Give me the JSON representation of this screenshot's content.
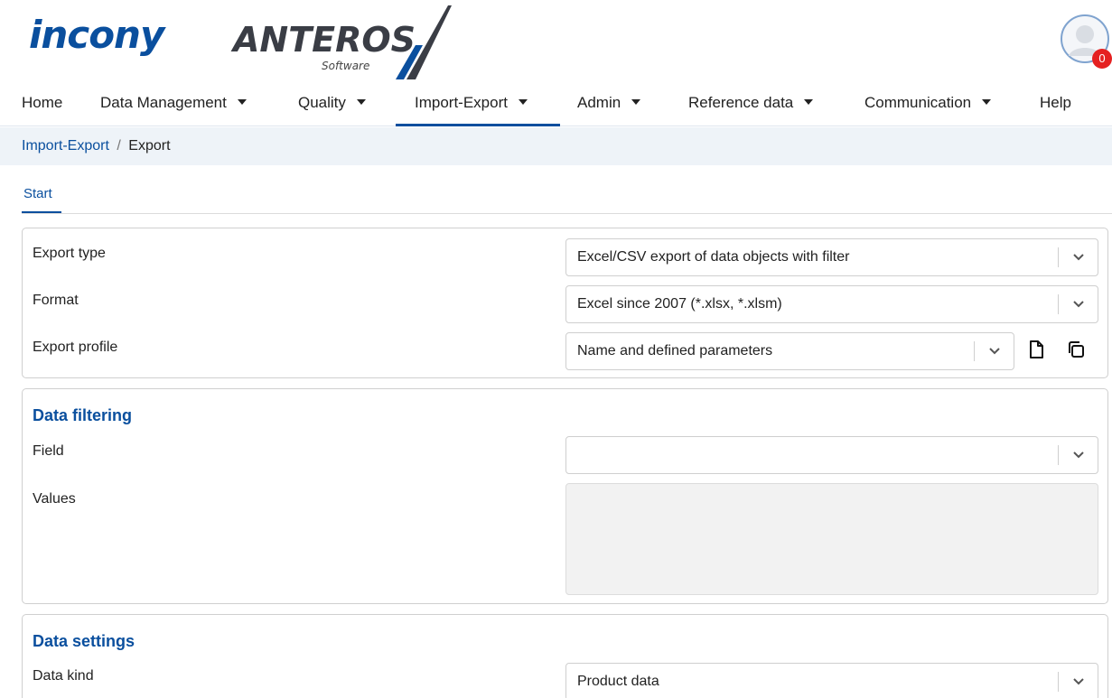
{
  "brand": {
    "logo_left": "incony",
    "logo_right": "ANTEROS",
    "logo_sub": "Software"
  },
  "notifications": {
    "count": "0"
  },
  "nav": {
    "items": [
      {
        "label": "Home",
        "has_caret": false
      },
      {
        "label": "Data Management",
        "has_caret": true
      },
      {
        "label": "Quality",
        "has_caret": true
      },
      {
        "label": "Import-Export",
        "has_caret": true,
        "active": true
      },
      {
        "label": "Admin",
        "has_caret": true
      },
      {
        "label": "Reference data",
        "has_caret": true
      },
      {
        "label": "Communication",
        "has_caret": true
      },
      {
        "label": "Help",
        "has_caret": false
      }
    ]
  },
  "breadcrumb": {
    "parent": "Import-Export",
    "separator": "/",
    "current": "Export"
  },
  "tabs": [
    {
      "label": "Start",
      "active": true
    }
  ],
  "export_panel": {
    "export_type_label": "Export type",
    "export_type_value": "Excel/CSV export of data objects with filter",
    "format_label": "Format",
    "format_value": "Excel since 2007 (*.xlsx, *.xlsm)",
    "profile_label": "Export profile",
    "profile_value": "Name and defined parameters"
  },
  "filter_panel": {
    "title": "Data filtering",
    "field_label": "Field",
    "field_value": "",
    "values_label": "Values"
  },
  "settings_panel": {
    "title": "Data settings",
    "data_kind_label": "Data kind",
    "data_kind_value": "Product data"
  },
  "colors": {
    "accent": "#0a4f9e",
    "breadcrumb_bg": "#eef3f8",
    "badge": "#e52020"
  }
}
